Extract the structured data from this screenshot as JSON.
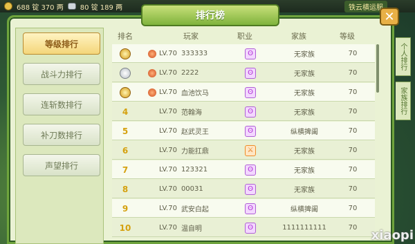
{
  "topbar": {
    "gold": "688 锭 370 两",
    "silver": "80 锭 189 两",
    "right_label": "铁云横运服"
  },
  "title": "排行榜",
  "close_label": "✕",
  "left_tabs": [
    {
      "label": "等级排行",
      "active": true
    },
    {
      "label": "战斗力排行",
      "active": false
    },
    {
      "label": "连斩数排行",
      "active": false
    },
    {
      "label": "补刀数排行",
      "active": false
    },
    {
      "label": "声望排行",
      "active": false
    }
  ],
  "columns": [
    "排名",
    "玩家",
    "职业",
    "家族",
    "等级"
  ],
  "rows": [
    {
      "rank": "",
      "medal": "gold",
      "lv": "LV.70",
      "name": "333333",
      "job": "purple",
      "family": "无家族",
      "level": "70"
    },
    {
      "rank": "",
      "medal": "silver",
      "lv": "LV.70",
      "name": "2222",
      "job": "purple",
      "family": "无家族",
      "level": "70"
    },
    {
      "rank": "",
      "medal": "gold",
      "lv": "LV.70",
      "name": "血池饮马",
      "job": "purple",
      "family": "无家族",
      "level": "70"
    },
    {
      "rank": "4",
      "medal": "",
      "lv": "LV.70",
      "name": "范翰海",
      "job": "purple",
      "family": "无家族",
      "level": "70"
    },
    {
      "rank": "5",
      "medal": "",
      "lv": "LV.70",
      "name": "赵武灵王",
      "job": "purple",
      "family": "纵横捭阖",
      "level": "70"
    },
    {
      "rank": "6",
      "medal": "",
      "lv": "LV.70",
      "name": "力能扛鼎",
      "job": "orange",
      "family": "无家族",
      "level": "70"
    },
    {
      "rank": "7",
      "medal": "",
      "lv": "LV.70",
      "name": "123321",
      "job": "purple",
      "family": "无家族",
      "level": "70"
    },
    {
      "rank": "8",
      "medal": "",
      "lv": "LV.70",
      "name": "00031",
      "job": "purple",
      "family": "无家族",
      "level": "70"
    },
    {
      "rank": "9",
      "medal": "",
      "lv": "LV.70",
      "name": "武安白起",
      "job": "purple",
      "family": "纵横捭阖",
      "level": "70"
    },
    {
      "rank": "10",
      "medal": "",
      "lv": "LV.70",
      "name": "温自明",
      "job": "purple",
      "family": "1111111111",
      "level": "70"
    }
  ],
  "side_tabs": [
    "个人排行",
    "家族排行"
  ],
  "watermark": "xiaopi"
}
